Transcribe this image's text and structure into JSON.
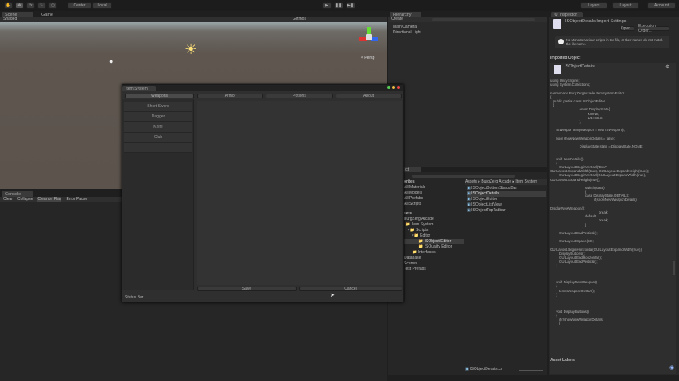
{
  "toolbar": {
    "tools": [
      "hand-tool",
      "move-tool",
      "rotate-tool",
      "scale-tool",
      "rect-tool"
    ],
    "pivot": "Center",
    "space": "Local",
    "layers": "Layers",
    "layout": "Layout",
    "account": "Account"
  },
  "scene": {
    "tabs": [
      "Scene",
      "Game"
    ],
    "shading": "Shaded",
    "gizmos": "Gizmos",
    "persp": "< Persp"
  },
  "hierarchy": {
    "title": "Hierarchy",
    "create": "Create",
    "items": [
      "Main Camera",
      "Directional Light"
    ]
  },
  "item_system": {
    "title": "Item System",
    "tabs": [
      "Weapons",
      "Armor",
      "Potions",
      "About"
    ],
    "list": [
      "Short Sword",
      "Dagger",
      "Knife",
      "Club"
    ],
    "save": "Save",
    "cancel": "Cancel",
    "status": "Status Bar"
  },
  "console": {
    "title": "Console",
    "buttons": [
      "Clear",
      "Collapse",
      "Clear on Play",
      "Error Pause"
    ]
  },
  "project": {
    "title": "ct",
    "favorites_header": "orites",
    "favorites": [
      "All Materials",
      "All Models",
      "All Prefabs",
      "All Scripts"
    ],
    "assets_header": "sets",
    "tree": [
      "BurgZerg Arcade",
      "Item System",
      "Scripts",
      "Editor",
      "ISObject Editor",
      "ISQuality Editor",
      "Interfaces",
      "Database",
      "Scenes",
      "Test Prefabs"
    ],
    "breadcrumb": [
      "Assets",
      "BurgZerg Arcade",
      "Item System"
    ],
    "files": [
      "ISObjectBottomStatusBar",
      "ISObjectDetails",
      "ISObjectEditor",
      "ISObjectListView",
      "ISObjectTopTabbar"
    ],
    "selected_file": "ISObjectDetails.cs"
  },
  "inspector": {
    "title": "Inspector",
    "header": "ISObjectDetails Import Settings",
    "open": "Open...",
    "execution_order": "Execution Order...",
    "warning": "No MonoBehaviour scripts in the file, or their names do not match the file name.",
    "imported_object": "Imported Object",
    "asset_name": "ISObjectDetails",
    "asset_labels": "Asset Labels",
    "code": [
      "using UnityEngine;",
      "using System.Collections;",
      "",
      "namespace BurgZergArcade.ItemSystem.Editor",
      "{",
      "   public partial class ISObjectEditor",
      "   {",
      "                              enum DisplayState{",
      "                                       NONE,",
      "                                       DETAILS",
      "                              };",
      "",
      "      ISWeapon tempWeapon = new ISWeapon();",
      "",
      "      bool showNewWeaponDetails = false;",
      "",
      "                              DisplayState state = DisplayState.NONE;",
      "",
      "",
      "      void ItemDetails()",
      "      {",
      "         GUILayout.BeginVertical(\"Box\",",
      "GUILayout.ExpandWidth(true), GUILayout.ExpandHeight(true));",
      "         GUILayout.BeginVertical(GUILayout.ExpandWidth(true),",
      "GUILayout.ExpandHeight(true));",
      "",
      "                                    switch(state)",
      "                                    {",
      "                                    case DisplayState.DETAILS:",
      "                                             if(showNewWeaponDetails)",
      "",
      "DisplayNewWeapon();",
      "                                                  break;",
      "                                    default:",
      "                                                  break;",
      "                                    }",
      "",
      "         GUILayout.EndVertical();",
      "",
      "         GUILayout.Space(50);",
      "",
      "GUILayout.BeginHorizontal(GUILayout.ExpandWidth(true));",
      "         DisplayButtons();",
      "         GUILayout.EndHorizontal();",
      "         GUILayout.EndVertical();",
      "      }",
      "",
      "",
      "",
      "      void DisplayNewWeapon()",
      "      {",
      "         tempWeapon.OnGUI();",
      "      }",
      "",
      "",
      "",
      "      void DisplayButtons()",
      "      {",
      "         if (!showNewWeaponDetails)",
      "         {"
    ]
  },
  "colors": {
    "bg": "#1f1f1f",
    "panel": "#2a2a2a",
    "selection": "#3d3d3d"
  }
}
